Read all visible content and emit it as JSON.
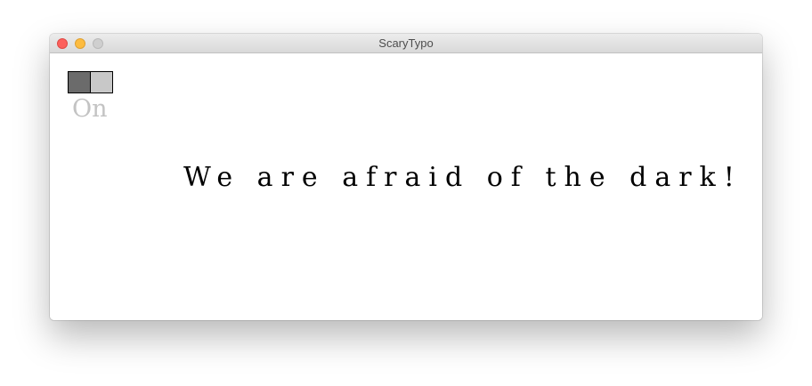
{
  "window": {
    "title": "ScaryTypo"
  },
  "toggle": {
    "label": "On",
    "on_color": "#6b6b6b",
    "off_color": "#c8c8c8"
  },
  "main": {
    "text": "We are afraid of the dark!"
  },
  "colors": {
    "close": "#fc605c",
    "minimize": "#fdbc40",
    "zoom": "#cfcfcf"
  }
}
